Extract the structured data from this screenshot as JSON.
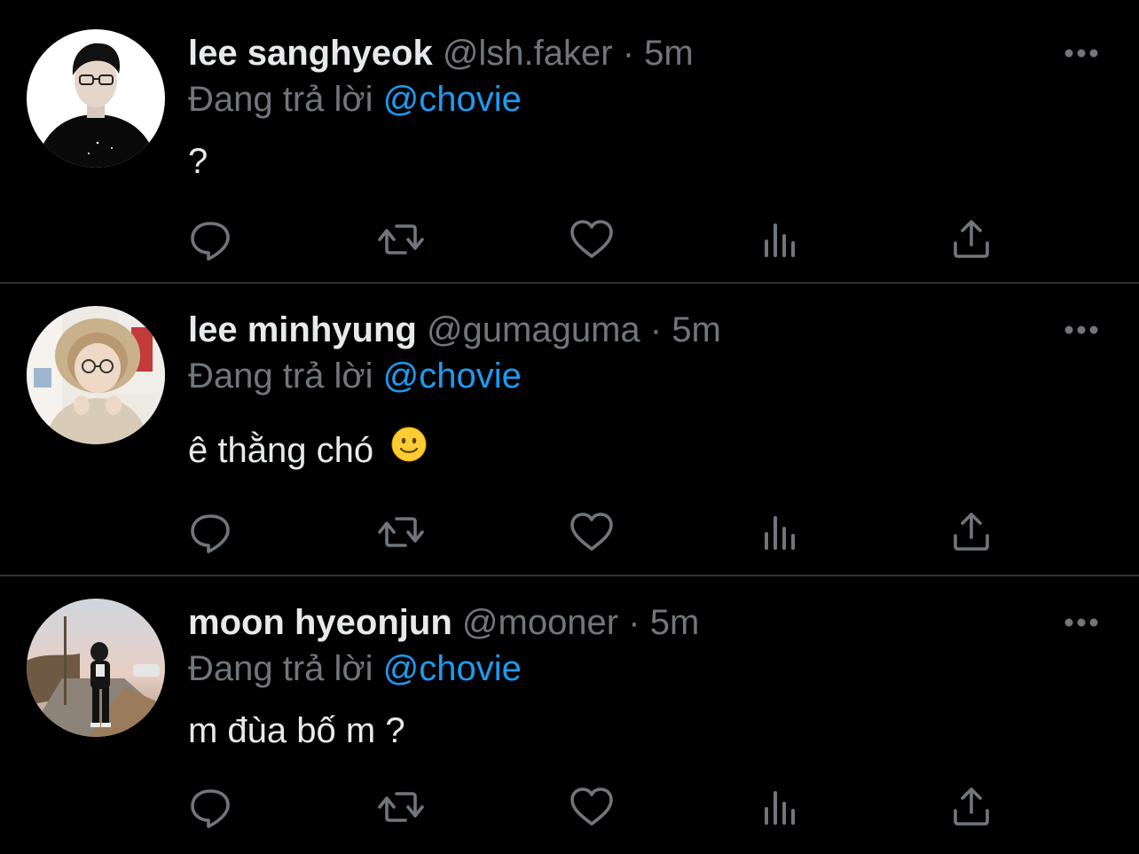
{
  "colors": {
    "background": "#000000",
    "divider": "#2f3336",
    "primary_text": "#e7e9ea",
    "secondary_text": "#71767b",
    "mention": "#1d9bf0"
  },
  "actions": [
    {
      "icon": "reply-icon"
    },
    {
      "icon": "retweet-icon"
    },
    {
      "icon": "like-icon"
    },
    {
      "icon": "views-icon"
    },
    {
      "icon": "share-icon"
    }
  ],
  "tweets": [
    {
      "name": "lee sanghyeok",
      "handle": "@lsh.faker",
      "separator": "·",
      "time": "5m",
      "reply_prefix": "Đang trả lời",
      "reply_to": "@chovie",
      "text": "?",
      "emoji": "",
      "more_icon": "more-icon"
    },
    {
      "name": "lee minhyung",
      "handle": "@gumaguma",
      "separator": "·",
      "time": "5m",
      "reply_prefix": "Đang trả lời",
      "reply_to": "@chovie",
      "text": "ê thằng chó",
      "emoji": "slightly-smiling-face",
      "more_icon": "more-icon"
    },
    {
      "name": "moon hyeonjun",
      "handle": "@mooner",
      "separator": "·",
      "time": "5m",
      "reply_prefix": "Đang trả lời",
      "reply_to": "@chovie",
      "text": "m đùa bố m ?",
      "emoji": "",
      "more_icon": "more-icon"
    }
  ]
}
